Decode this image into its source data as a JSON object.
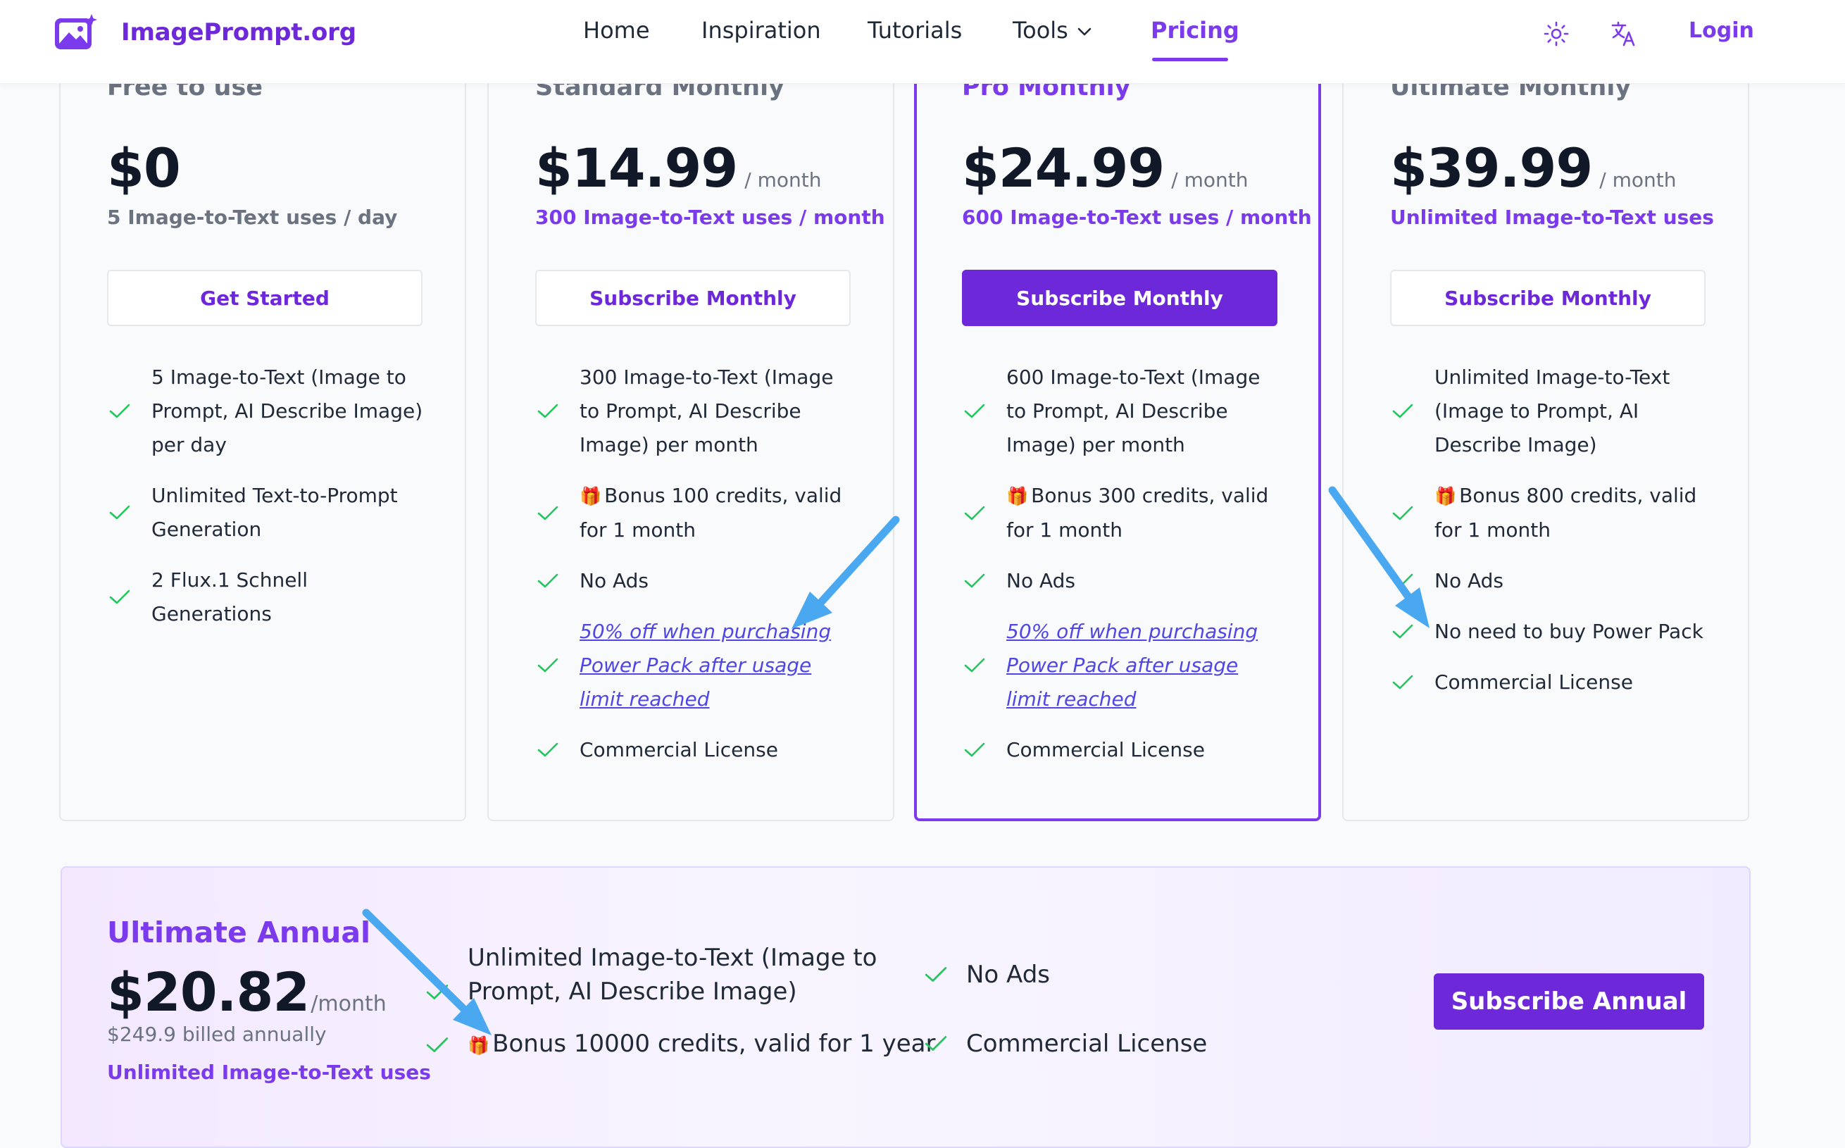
{
  "header": {
    "brand": "ImagePrompt.org",
    "nav": [
      "Home",
      "Inspiration",
      "Tutorials",
      "Tools",
      "Pricing"
    ],
    "active_nav": "Pricing",
    "login": "Login",
    "icons": [
      "sun-icon",
      "translate-icon"
    ]
  },
  "plans": [
    {
      "name": "Free to use",
      "price": "$0",
      "period": "",
      "uses": "5 Image-to-Text uses / day",
      "cta": "Get Started",
      "features": [
        "5 Image-to-Text (Image to Prompt, AI Describe Image) per day",
        "Unlimited Text-to-Prompt Generation",
        "2 Flux.1 Schnell Generations"
      ]
    },
    {
      "name": "Standard Monthly",
      "price": "$14.99",
      "period": "/ month",
      "uses": "300 Image-to-Text uses / month",
      "cta": "Subscribe Monthly",
      "features": [
        "300 Image-to-Text (Image to Prompt, AI Describe Image) per month",
        "Bonus 100 credits, valid for 1 month",
        "No Ads",
        "50% off when purchasing Power Pack after usage limit reached",
        "Commercial License"
      ]
    },
    {
      "name": "Pro Monthly",
      "price": "$24.99",
      "period": "/ month",
      "uses": "600 Image-to-Text uses / month",
      "cta": "Subscribe Monthly",
      "features": [
        "600 Image-to-Text (Image to Prompt, AI Describe Image) per month",
        "Bonus 300 credits, valid for 1 month",
        "No Ads",
        "50% off when purchasing Power Pack after usage limit reached",
        "Commercial License"
      ]
    },
    {
      "name": "Ultimate Monthly",
      "price": "$39.99",
      "period": "/ month",
      "uses": "Unlimited Image-to-Text uses",
      "cta": "Subscribe Monthly",
      "features": [
        "Unlimited Image-to-Text (Image to Prompt, AI Describe Image)",
        "Bonus 800 credits, valid for 1 month",
        "No Ads",
        "No need to buy Power Pack",
        "Commercial License"
      ]
    }
  ],
  "annual": {
    "name": "Ultimate Annual",
    "price": "$20.82",
    "period": "/month",
    "billed": "$249.9 billed annually",
    "uses": "Unlimited Image-to-Text uses",
    "features": [
      "Unlimited Image-to-Text (Image to Prompt, AI Describe Image)",
      "Bonus 10000 credits, valid for 1 year",
      "No Ads",
      "Commercial License"
    ],
    "cta": "Subscribe Annual"
  },
  "colors": {
    "accent": "#7c3aed",
    "accent_dark": "#6d28d9",
    "check": "#22c55e",
    "annotation_arrow": "#4aa8f0",
    "link": "#4f46e5"
  }
}
